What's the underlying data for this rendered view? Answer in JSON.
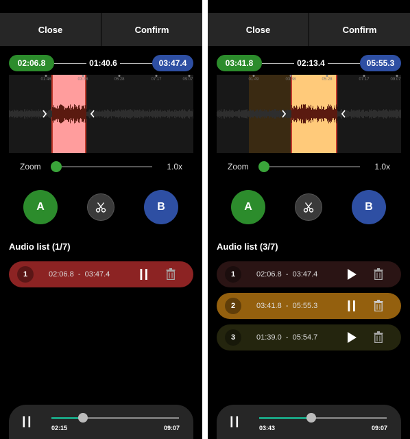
{
  "screens": [
    {
      "topbar": {
        "close_label": "Close",
        "confirm_label": "Confirm"
      },
      "timeline": {
        "start": "02:06.8",
        "duration": "01:40.6",
        "end": "03:47.4"
      },
      "ticks": [
        "01:48",
        "03:38",
        "05:28",
        "07:17",
        "09:07"
      ],
      "zoom": {
        "label": "Zoom",
        "value": "1.0x",
        "level": 0.0
      },
      "buttons": {
        "a_label": "A",
        "b_label": "B"
      },
      "list_title": "Audio list (1/7)",
      "items": [
        {
          "num": "1",
          "start": "02:06.8",
          "end": "03:47.4",
          "state": "playing",
          "color": "#8c2323"
        }
      ],
      "player": {
        "current": "02:15",
        "total": "09:07",
        "progress": 0.247
      },
      "selection_color": "#ff9d9d",
      "icons": [
        "chevron-right-icon",
        "chevron-left-icon",
        "scissors-icon",
        "pause-icon",
        "play-icon",
        "trash-icon"
      ]
    },
    {
      "topbar": {
        "close_label": "Close",
        "confirm_label": "Confirm"
      },
      "timeline": {
        "start": "03:41.8",
        "duration": "02:13.4",
        "end": "05:55.3"
      },
      "ticks": [
        "01:49",
        "03:38",
        "05:28",
        "07:17",
        "09:07"
      ],
      "zoom": {
        "label": "Zoom",
        "value": "1.0x",
        "level": 0.0
      },
      "buttons": {
        "a_label": "A",
        "b_label": "B"
      },
      "list_title": "Audio list (3/7)",
      "items": [
        {
          "num": "1",
          "start": "02:06.8",
          "end": "03:47.4",
          "state": "stopped",
          "color": "#2a1414"
        },
        {
          "num": "2",
          "start": "03:41.8",
          "end": "05:55.3",
          "state": "playing",
          "color": "#94600e"
        },
        {
          "num": "3",
          "start": "01:39.0",
          "end": "05:54.7",
          "state": "stopped",
          "color": "#24250e"
        }
      ],
      "player": {
        "current": "03:43",
        "total": "09:07",
        "progress": 0.41
      },
      "selection_color": "#ffca7a",
      "icons": [
        "chevron-right-icon",
        "chevron-left-icon",
        "scissors-icon",
        "pause-icon",
        "play-icon",
        "trash-icon"
      ]
    }
  ]
}
